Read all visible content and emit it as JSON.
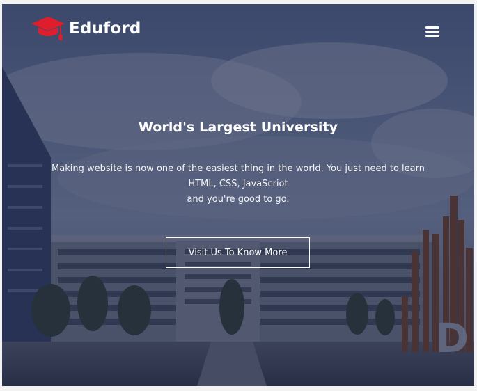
{
  "brand": {
    "name": "Eduford",
    "logo_icon": "graduation-cap-icon",
    "accent_color": "#e01e2b"
  },
  "nav": {
    "menu_icon": "hamburger-menu-icon"
  },
  "hero": {
    "title": "World's Largest University",
    "description_line1": "Making website is now one of the easiest thing in the world. You just need to learn",
    "description_line2": "HTML, CSS, JavaScriot",
    "description_line3": "and you're good to go.",
    "cta_label": "Visit Us To Know More",
    "overlay_color": "#141e41"
  }
}
